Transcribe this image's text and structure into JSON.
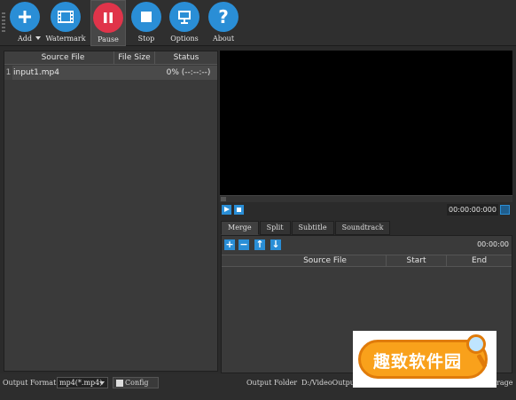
{
  "toolbar": {
    "buttons": [
      {
        "label": "Add",
        "icon": "plus-icon"
      },
      {
        "label": "Watermark",
        "icon": "film-icon"
      },
      {
        "label": "Pause",
        "icon": "pause-icon"
      },
      {
        "label": "Stop",
        "icon": "stop-icon"
      },
      {
        "label": "Options",
        "icon": "monitor-icon"
      },
      {
        "label": "About",
        "icon": "question-icon"
      }
    ]
  },
  "file_list": {
    "columns": [
      "Source File",
      "File Size",
      "Status"
    ],
    "rows": [
      {
        "index": "1",
        "source": "input1.mp4",
        "size": "",
        "status": "0% (--:--:--)"
      }
    ]
  },
  "player": {
    "time": "00:00:00:000"
  },
  "tabs": [
    "Merge",
    "Split",
    "Subtitle",
    "Soundtrack"
  ],
  "merge": {
    "time": "00:00:00",
    "columns": [
      "Source File",
      "Start",
      "End"
    ]
  },
  "statusbar": {
    "output_format_label": "Output Format",
    "output_format_value": "mp4(*.mp4)",
    "config_label": "Config",
    "output_folder_label": "Output Folder",
    "output_folder_value": "D:/VideoOutpu",
    "trailing_text": "rage"
  },
  "watermark_badge": {
    "text": "趣致软件园"
  },
  "colors": {
    "accent": "#2a8ed6",
    "pause_red": "#e0344a",
    "background": "#2b2b2b",
    "badge_orange": "#f9a11b"
  }
}
